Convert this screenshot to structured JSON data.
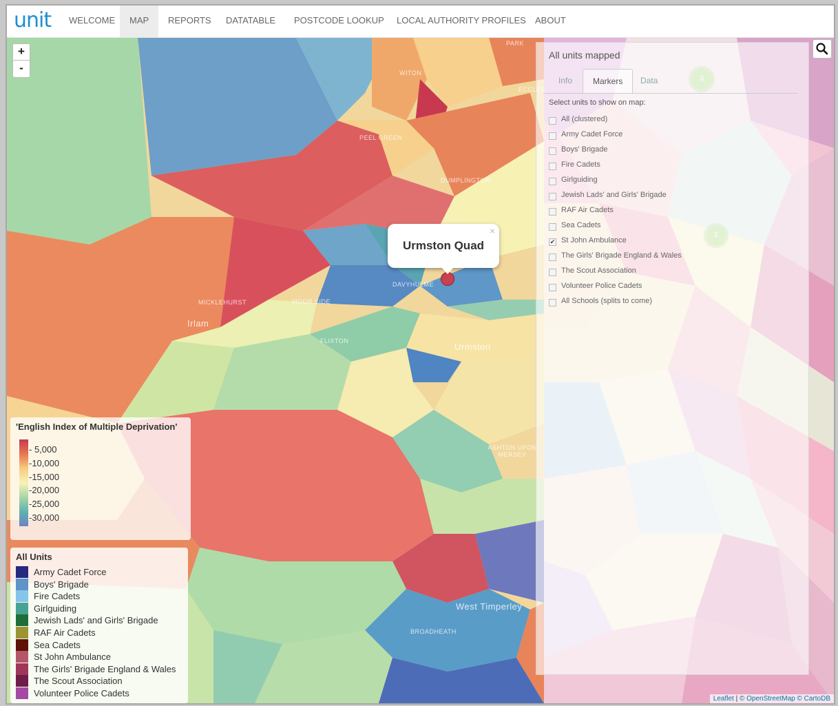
{
  "app": {
    "logo": "unit"
  },
  "nav": {
    "items": [
      {
        "label": "WELCOME",
        "active": false
      },
      {
        "label": "MAP",
        "active": true
      },
      {
        "label": "REPORTS",
        "active": false
      },
      {
        "label": "DATATABLE",
        "active": false
      },
      {
        "label": "POSTCODE LOOKUP",
        "active": false
      },
      {
        "label": "LOCAL AUTHORITY PROFILES",
        "active": false
      },
      {
        "label": "ABOUT",
        "active": false
      }
    ]
  },
  "map": {
    "zoom_in": "+",
    "zoom_out": "-",
    "search_icon": "search-icon",
    "places": [
      "PARK",
      "WITON",
      "ECCLES",
      "PEEL GREEN",
      "DUMPLINGTON",
      "DAVYHULME",
      "MICKLEHURST",
      "MOOR SIDE",
      "Irlam",
      "Flixton",
      "Urmston",
      "ASHTON UPON MERSEY",
      "West Timperley",
      "BROADHEATH"
    ],
    "clusters": [
      "3",
      "2"
    ],
    "popup": {
      "title": "Urmston Quad",
      "close": "×"
    },
    "attribution": {
      "leaflet": "Leaflet",
      "osm": "© OpenStreetMap",
      "carto": "© CartoDB",
      "sep": " | "
    }
  },
  "panel": {
    "title": "All units mapped",
    "tabs": [
      {
        "label": "Info",
        "active": false
      },
      {
        "label": "Markers",
        "active": true
      },
      {
        "label": "Data",
        "active": false
      }
    ],
    "select_label": "Select units to show on map:",
    "options": [
      {
        "label": "All (clustered)",
        "checked": false
      },
      {
        "label": "Army Cadet Force",
        "checked": false
      },
      {
        "label": "Boys' Brigade",
        "checked": false
      },
      {
        "label": "Fire Cadets",
        "checked": false
      },
      {
        "label": "Girlguiding",
        "checked": false
      },
      {
        "label": "Jewish Lads' and Girls' Brigade",
        "checked": false
      },
      {
        "label": "RAF Air Cadets",
        "checked": false
      },
      {
        "label": "Sea Cadets",
        "checked": false
      },
      {
        "label": "St John Ambulance",
        "checked": true
      },
      {
        "label": "The Girls' Brigade England & Wales",
        "checked": false
      },
      {
        "label": "The Scout Association",
        "checked": false
      },
      {
        "label": "Volunteer Police Cadets",
        "checked": false
      },
      {
        "label": "All Schools (splits to come)",
        "checked": false
      }
    ],
    "checkmark": "✔"
  },
  "legend_imd": {
    "title": "'English Index of Multiple Deprivation'",
    "ticks": [
      "- 5,000",
      "-10,000",
      "-15,000",
      "-20,000",
      "-25,000",
      "-30,000"
    ]
  },
  "legend_units": {
    "title": "All Units",
    "items": [
      {
        "label": "Army Cadet Force",
        "color": "#262a80"
      },
      {
        "label": "Boys' Brigade",
        "color": "#5e94c8"
      },
      {
        "label": "Fire Cadets",
        "color": "#86c4ea"
      },
      {
        "label": "Girlguiding",
        "color": "#47a393"
      },
      {
        "label": "Jewish Lads' and Girls' Brigade",
        "color": "#1f6e3a"
      },
      {
        "label": "RAF Air Cadets",
        "color": "#9a9434"
      },
      {
        "label": "Sea Cadets",
        "color": "#5e1208"
      },
      {
        "label": "St John Ambulance",
        "color": "#b4566a"
      },
      {
        "label": "The Girls' Brigade England & Wales",
        "color": "#a0365a"
      },
      {
        "label": "The Scout Association",
        "color": "#6e1c48"
      },
      {
        "label": "Volunteer Police Cadets",
        "color": "#a44aa2"
      }
    ]
  }
}
